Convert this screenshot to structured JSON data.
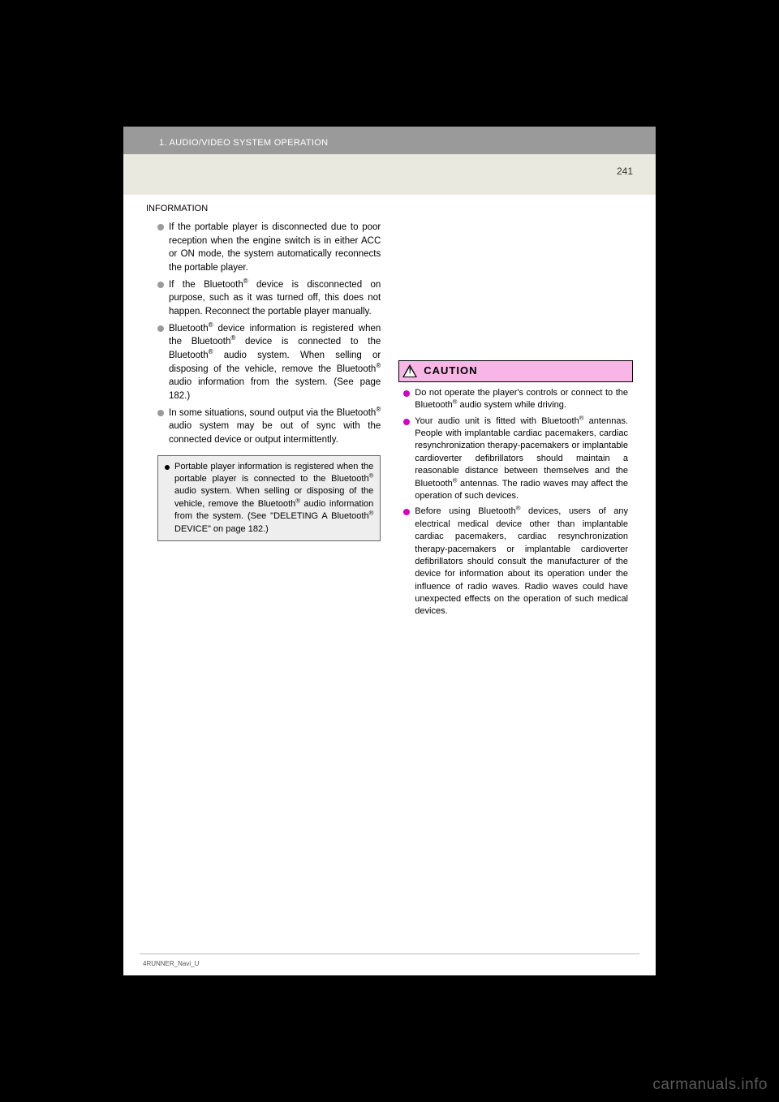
{
  "header": {
    "section": "1. AUDIO/VIDEO SYSTEM OPERATION",
    "page_number": "241"
  },
  "left": {
    "information_label": "INFORMATION",
    "bullets": [
      "If the portable player is disconnected due to poor reception when the engine switch is in either ACC or ON mode, the system automatically reconnects the portable player.",
      "If the Bluetooth® device is disconnected on purpose, such as it was turned off, this does not happen. Reconnect the portable player manually.",
      "Bluetooth® device information is registered when the Bluetooth® device is connected to the Bluetooth® audio system. When selling or disposing of the vehicle, remove the Bluetooth® audio information from the system. (See page 182.)",
      "In some situations, sound output via the Bluetooth® audio system may be out of sync with the connected device or output intermittently."
    ],
    "note": "Portable player information is registered when the portable player is connected to the Bluetooth® audio system. When selling or disposing of the vehicle, remove the Bluetooth® audio information from the system. (See \"DELETING A Bluetooth® DEVICE\" on page 182.)"
  },
  "right": {
    "caution_title": "CAUTION",
    "caution_items": [
      "Do not operate the player's controls or connect to the Bluetooth® audio system while driving.",
      "Your audio unit is fitted with Bluetooth® antennas. People with implantable cardiac pacemakers, cardiac resynchronization therapy-pacemakers or implantable cardioverter defibrillators should maintain a reasonable distance between themselves and the Bluetooth® antennas. The radio waves may affect the operation of such devices.",
      "Before using Bluetooth® devices, users of any electrical medical device other than implantable cardiac pacemakers, cardiac resynchronization therapy-pacemakers or implantable cardioverter defibrillators should consult the manufacturer of the device for information about its operation under the influence of radio waves. Radio waves could have unexpected effects on the operation of such medical devices."
    ]
  },
  "footer": {
    "code": "4RUNNER_Navi_U",
    "watermark": "carmanuals.info"
  }
}
